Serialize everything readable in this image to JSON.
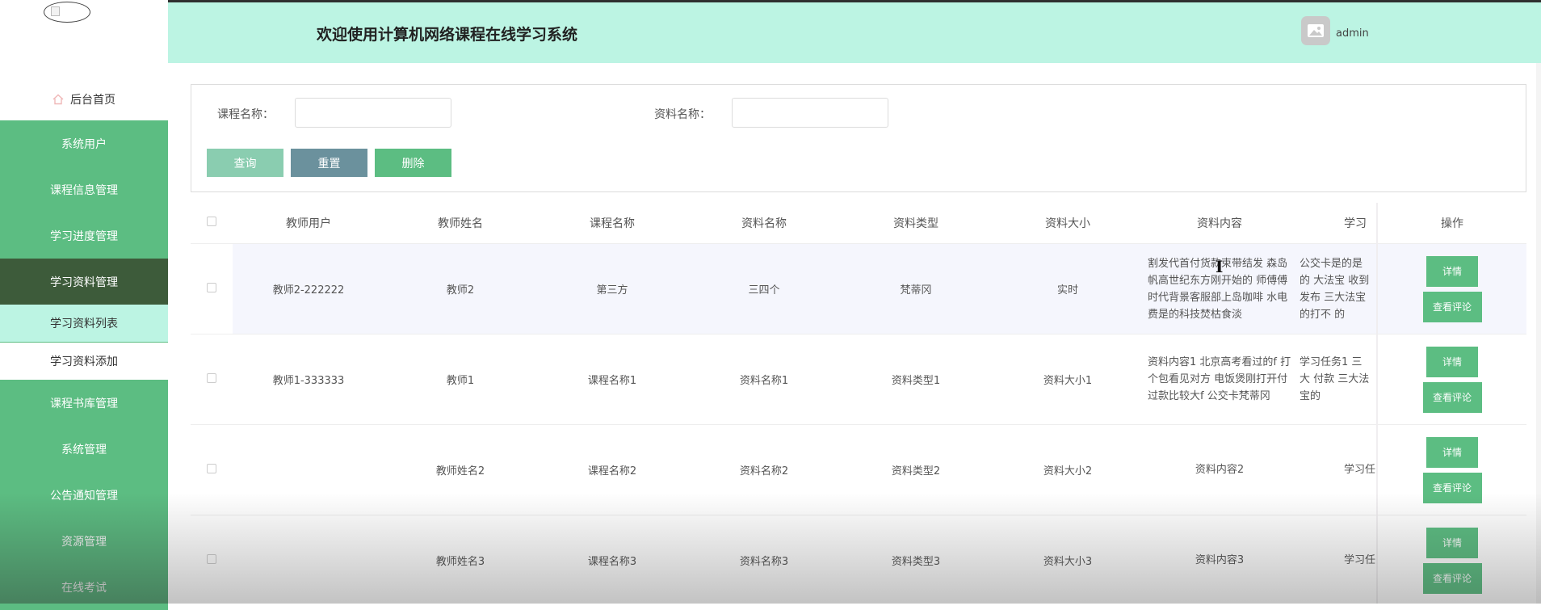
{
  "header": {
    "title": "欢迎使用计算机网络课程在线学习系统",
    "username": "admin"
  },
  "sidebar": {
    "home_label": "后台首页",
    "items": [
      {
        "label": "系统用户"
      },
      {
        "label": "课程信息管理"
      },
      {
        "label": "学习进度管理"
      },
      {
        "label": "学习资料管理",
        "active": true
      },
      {
        "label": "课程书库管理"
      },
      {
        "label": "系统管理"
      },
      {
        "label": "公告通知管理"
      },
      {
        "label": "资源管理"
      },
      {
        "label": "在线考试"
      }
    ],
    "subitems": [
      {
        "label": "学习资料列表",
        "selected": true
      },
      {
        "label": "学习资料添加"
      }
    ]
  },
  "search": {
    "course_label": "课程名称：",
    "course_value": "",
    "material_label": "资料名称：",
    "material_value": "",
    "search_button": "查询",
    "reset_button": "重置",
    "delete_button": "删除"
  },
  "table": {
    "columns": [
      "教师用户",
      "教师姓名",
      "课程名称",
      "资料名称",
      "资料类型",
      "资料大小",
      "资料内容",
      "学习",
      "操作"
    ],
    "rows": [
      {
        "teacher_user": "教师2-222222",
        "teacher_name": "教师2",
        "course": "第三方",
        "material": "三四个",
        "type": "梵蒂冈",
        "size": "实时",
        "content": "割发代首付货款束带结发 森岛帆高世纪东方刚开始的 师傅傅 时代背景客服部上岛咖啡 水电费是的科技焚枯食淡",
        "task": "公交卡是的是的 大法宝 收到发布 三大法宝的打不 的"
      },
      {
        "teacher_user": "教师1-333333",
        "teacher_name": "教师1",
        "course": "课程名称1",
        "material": "资料名称1",
        "type": "资料类型1",
        "size": "资料大小1",
        "content": "资料内容1 北京高考看过的f 打个包看见对方 电饭煲刚打开付过款比较大f 公交卡梵蒂冈",
        "task": "学习任务1 三大 付款 三大法宝的"
      },
      {
        "teacher_user": "",
        "teacher_name": "教师姓名2",
        "course": "课程名称2",
        "material": "资料名称2",
        "type": "资料类型2",
        "size": "资料大小2",
        "content": "资料内容2",
        "task": "学习任"
      },
      {
        "teacher_user": "",
        "teacher_name": "教师姓名3",
        "course": "课程名称3",
        "material": "资料名称3",
        "type": "资料类型3",
        "size": "资料大小3",
        "content": "资料内容3",
        "task": "学习任"
      }
    ],
    "detail_button": "详情",
    "comment_button": "查看评论"
  }
}
